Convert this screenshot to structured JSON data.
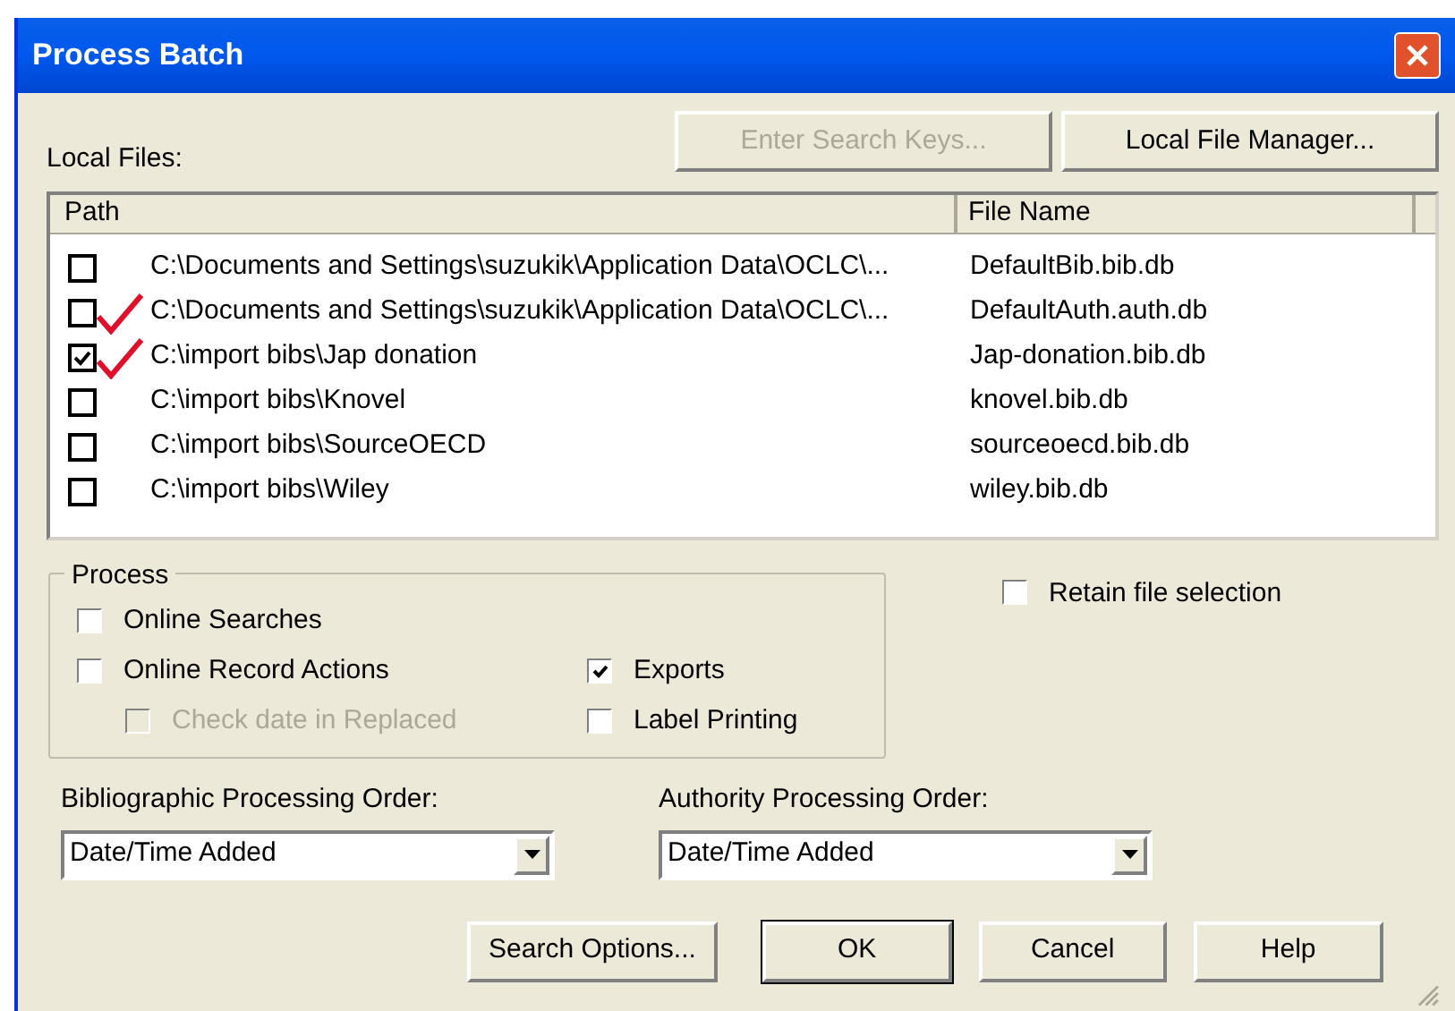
{
  "window": {
    "title": "Process Batch"
  },
  "local_files": {
    "label": "Local Files:",
    "buttons": [
      {
        "label": "Enter Search Keys...",
        "disabled": true
      },
      {
        "label": "Local File Manager...",
        "disabled": false
      }
    ],
    "columns": [
      "Path",
      "File Name"
    ],
    "rows": [
      {
        "path": "C:\\Documents and Settings\\suzukik\\Application Data\\OCLC\\...",
        "file": "DefaultBib.bib.db",
        "checked": false,
        "marked": false
      },
      {
        "path": "C:\\Documents and Settings\\suzukik\\Application Data\\OCLC\\...",
        "file": "DefaultAuth.auth.db",
        "checked": false,
        "marked": true
      },
      {
        "path": "C:\\import bibs\\Jap donation",
        "file": "Jap-donation.bib.db",
        "checked": true,
        "marked": true
      },
      {
        "path": "C:\\import bibs\\Knovel",
        "file": "knovel.bib.db",
        "checked": false,
        "marked": false
      },
      {
        "path": "C:\\import bibs\\SourceOECD",
        "file": "sourceoecd.bib.db",
        "checked": false,
        "marked": false
      },
      {
        "path": "C:\\import bibs\\Wiley",
        "file": "wiley.bib.db",
        "checked": false,
        "marked": false
      }
    ]
  },
  "process": {
    "title": "Process",
    "options": [
      {
        "label": "Online Searches",
        "checked": false,
        "disabled": false
      },
      {
        "label": "Online Record Actions",
        "checked": false,
        "disabled": false
      },
      {
        "label": "Check date in Replaced",
        "checked": false,
        "disabled": true
      },
      {
        "label": "Exports",
        "checked": true,
        "disabled": false
      },
      {
        "label": "Label Printing",
        "checked": false,
        "disabled": false
      }
    ]
  },
  "retain": {
    "label": "Retain file selection",
    "checked": false
  },
  "orders": [
    {
      "label": "Bibliographic Processing Order:",
      "value": "Date/Time Added"
    },
    {
      "label": "Authority Processing Order:",
      "value": "Date/Time Added"
    }
  ],
  "buttons": [
    {
      "label": "Search Options...",
      "default": false
    },
    {
      "label": "OK",
      "default": true
    },
    {
      "label": "Cancel",
      "default": false
    },
    {
      "label": "Help",
      "default": false
    }
  ]
}
